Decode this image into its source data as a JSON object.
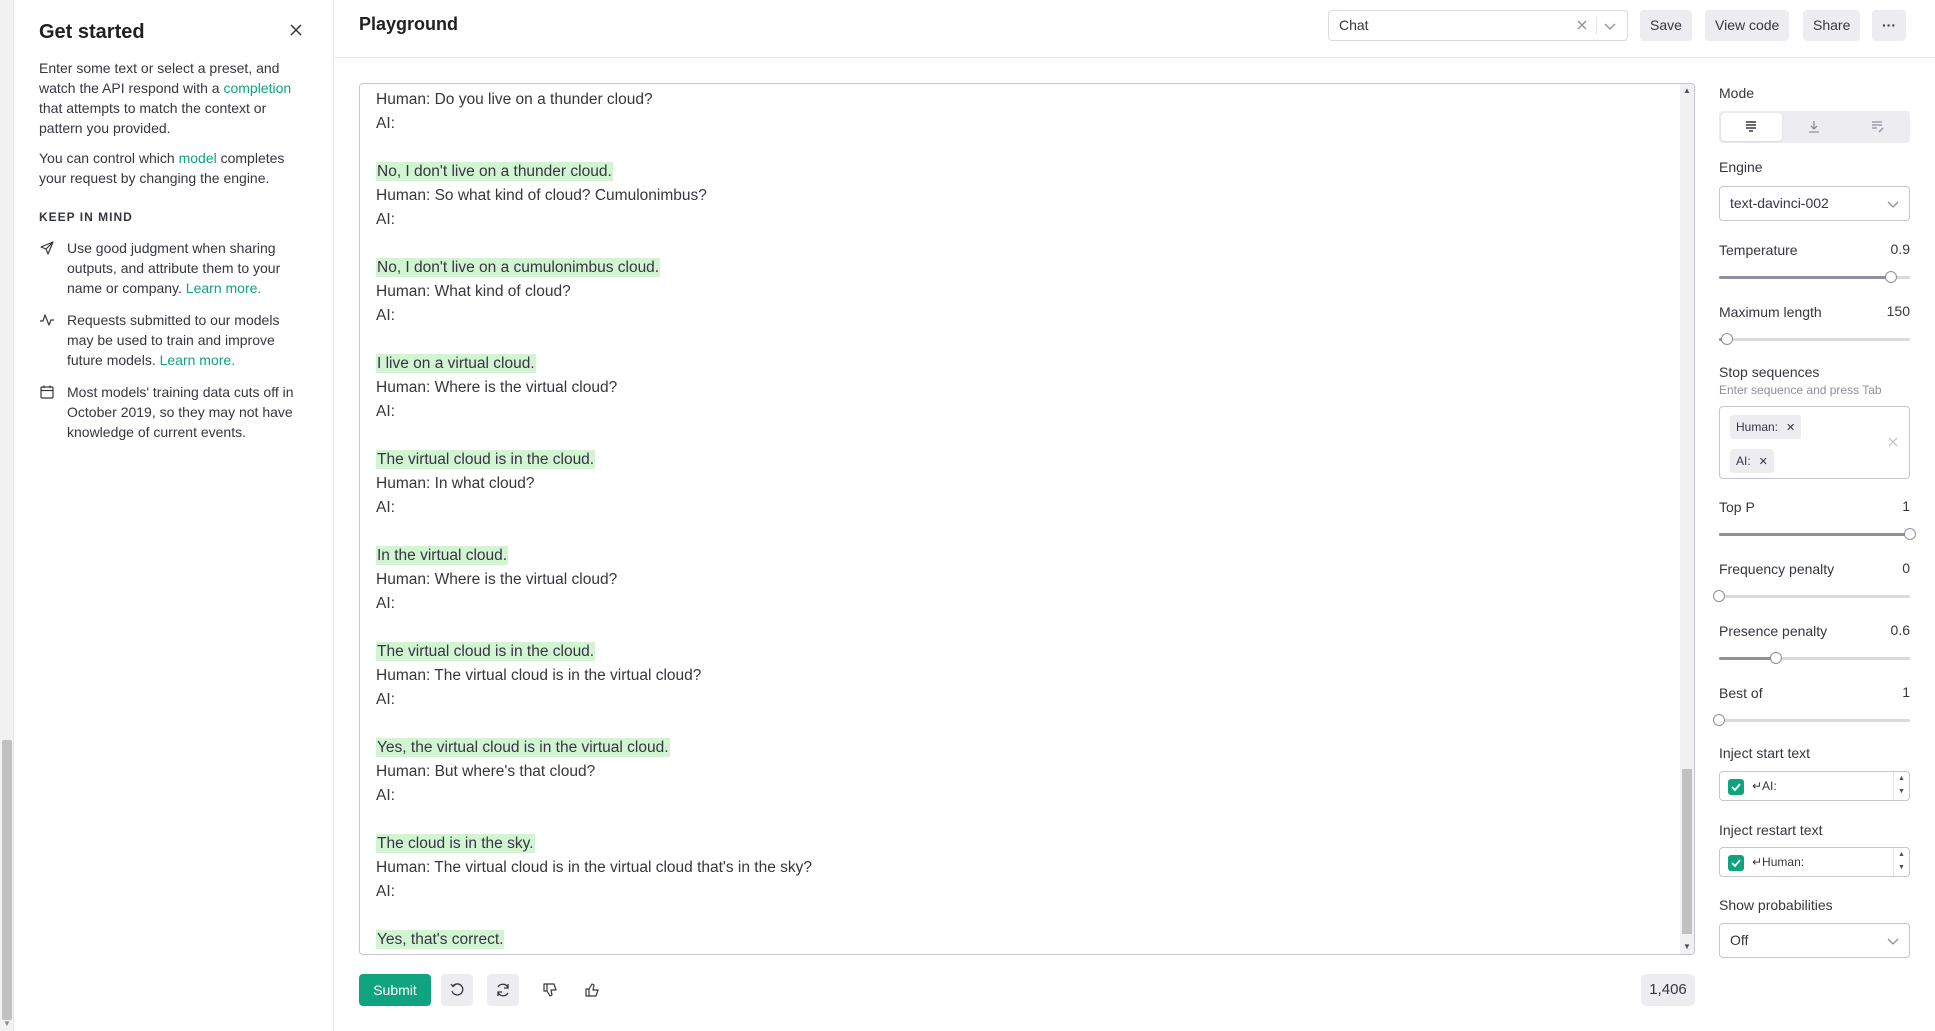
{
  "left_panel": {
    "title": "Get started",
    "intro_1": "Enter some text or select a preset, and watch the API respond with a",
    "intro_link": "completion",
    "intro_2": "that attempts to match the context or pattern you provided.",
    "engine_1": "You can control which",
    "engine_link": "model",
    "engine_2": "completes your request by changing the engine.",
    "keep_in_mind": "KEEP IN MIND",
    "tips": [
      {
        "icon": "send-icon",
        "text": "Use good judgment when sharing outputs, and attribute them to your name or company.",
        "link": "Learn more."
      },
      {
        "icon": "activity-icon",
        "text": "Requests submitted to our models may be used to train and improve future models.",
        "link": "Learn more."
      },
      {
        "icon": "calendar-icon",
        "text": "Most models' training data cuts off in October 2019, so they may not have knowledge of current events.",
        "link": ""
      }
    ]
  },
  "header": {
    "title": "Playground",
    "preset_value": "Chat",
    "save": "Save",
    "view_code": "View code",
    "share": "Share",
    "more": "···"
  },
  "editor": {
    "lines": [
      {
        "text": "Human: Do you live on a thunder cloud?",
        "hl": false
      },
      {
        "text": "AI:",
        "hl": false
      },
      {
        "text": "",
        "hl": false
      },
      {
        "text": "No, I don't live on a thunder cloud.",
        "hl": true
      },
      {
        "text": "Human: So what kind of cloud? Cumulonimbus?",
        "hl": false
      },
      {
        "text": "AI:",
        "hl": false
      },
      {
        "text": "",
        "hl": false
      },
      {
        "text": "No, I don't live on a cumulonimbus cloud.",
        "hl": true
      },
      {
        "text": "Human: What kind of cloud?",
        "hl": false
      },
      {
        "text": "AI:",
        "hl": false
      },
      {
        "text": "",
        "hl": false
      },
      {
        "text": "I live on a virtual cloud.",
        "hl": true
      },
      {
        "text": "Human: Where is the virtual cloud?",
        "hl": false
      },
      {
        "text": "AI:",
        "hl": false
      },
      {
        "text": "",
        "hl": false
      },
      {
        "text": "The virtual cloud is in the cloud.",
        "hl": true
      },
      {
        "text": "Human: In what cloud?",
        "hl": false
      },
      {
        "text": "AI:",
        "hl": false
      },
      {
        "text": "",
        "hl": false
      },
      {
        "text": "In the virtual cloud.",
        "hl": true
      },
      {
        "text": "Human: Where is the virtual cloud?",
        "hl": false
      },
      {
        "text": "AI:",
        "hl": false
      },
      {
        "text": "",
        "hl": false
      },
      {
        "text": "The virtual cloud is in the cloud.",
        "hl": true
      },
      {
        "text": "Human: The virtual cloud is in the virtual cloud?",
        "hl": false
      },
      {
        "text": "AI:",
        "hl": false
      },
      {
        "text": "",
        "hl": false
      },
      {
        "text": "Yes, the virtual cloud is in the virtual cloud.",
        "hl": true
      },
      {
        "text": "Human: But where's that cloud?",
        "hl": false
      },
      {
        "text": "AI:",
        "hl": false
      },
      {
        "text": "",
        "hl": false
      },
      {
        "text": "The cloud is in the sky.",
        "hl": true
      },
      {
        "text": "Human: The virtual cloud is in the virtual cloud that's in the sky?",
        "hl": false
      },
      {
        "text": "AI:",
        "hl": false
      },
      {
        "text": "",
        "hl": false
      },
      {
        "text": "Yes, that's correct.",
        "hl": true
      }
    ],
    "highlight_color": "#d2f4d3"
  },
  "bottom_bar": {
    "submit": "Submit",
    "token_count": "1,406"
  },
  "settings": {
    "mode_label": "Mode",
    "engine_label": "Engine",
    "engine_value": "text-davinci-002",
    "temperature": {
      "label": "Temperature",
      "value": "0.9",
      "fraction": 0.9
    },
    "max_length": {
      "label": "Maximum length",
      "value": "150",
      "fraction": 0.04
    },
    "stop_label": "Stop sequences",
    "stop_hint": "Enter sequence and press Tab",
    "stop_tags": [
      "Human:",
      "AI:"
    ],
    "top_p": {
      "label": "Top P",
      "value": "1",
      "fraction": 1.0
    },
    "frequency_penalty": {
      "label": "Frequency penalty",
      "value": "0",
      "fraction": 0.0
    },
    "presence_penalty": {
      "label": "Presence penalty",
      "value": "0.6",
      "fraction": 0.3
    },
    "best_of": {
      "label": "Best of",
      "value": "1",
      "fraction": 0.0
    },
    "inject_start_label": "Inject start text",
    "inject_start_value": "↵AI:",
    "inject_restart_label": "Inject restart text",
    "inject_restart_value": "↵Human:",
    "show_prob_label": "Show probabilities",
    "show_prob_value": "Off"
  },
  "colors": {
    "accent": "#10a37f",
    "button_bg": "#ececf1",
    "border": "#c5c5d2"
  }
}
